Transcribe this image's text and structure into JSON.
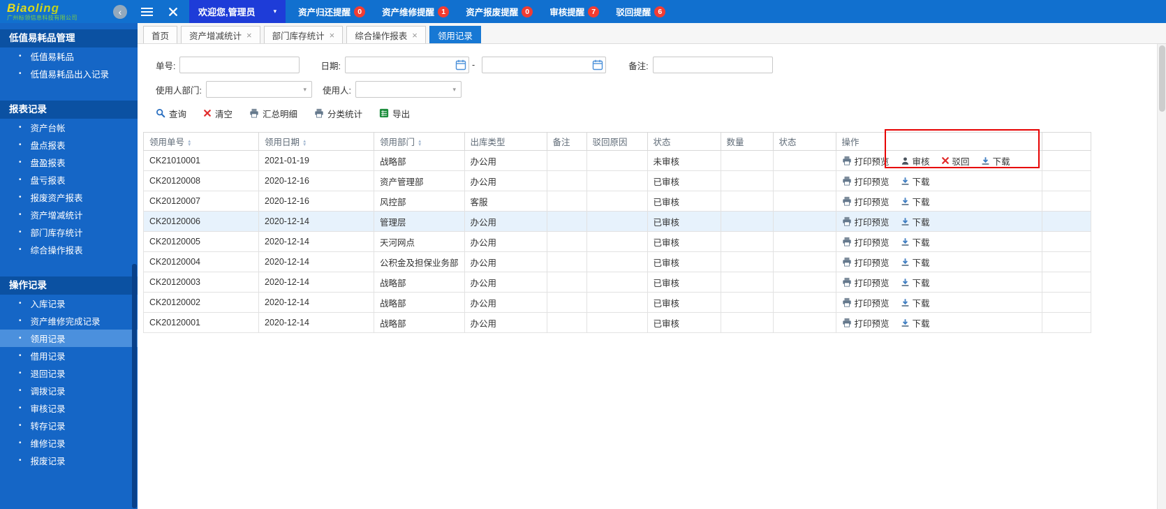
{
  "topbar": {
    "brand": "Biaoling",
    "brand_sub": "广州标领信息科技有限公司",
    "welcome_label": "欢迎您,管理员",
    "notifications": [
      {
        "label": "资产归还提醒",
        "count": "0"
      },
      {
        "label": "资产维修提醒",
        "count": "1"
      },
      {
        "label": "资产报废提醒",
        "count": "0"
      },
      {
        "label": "审核提醒",
        "count": "7"
      },
      {
        "label": "驳回提醒",
        "count": "6"
      }
    ]
  },
  "sidebar": {
    "sections": [
      {
        "title": "低值易耗品管理",
        "items": [
          {
            "label": "低值易耗品",
            "active": false
          },
          {
            "label": "低值易耗品出入记录",
            "active": false
          }
        ]
      },
      {
        "title": "报表记录",
        "items": [
          {
            "label": "资产台帐",
            "active": false
          },
          {
            "label": "盘点报表",
            "active": false
          },
          {
            "label": "盘盈报表",
            "active": false
          },
          {
            "label": "盘亏报表",
            "active": false
          },
          {
            "label": "报废资产报表",
            "active": false
          },
          {
            "label": "资产增减统计",
            "active": false
          },
          {
            "label": "部门库存统计",
            "active": false
          },
          {
            "label": "综合操作报表",
            "active": false
          }
        ]
      },
      {
        "title": "操作记录",
        "items": [
          {
            "label": "入库记录",
            "active": false
          },
          {
            "label": "资产维修完成记录",
            "active": false
          },
          {
            "label": "领用记录",
            "active": true
          },
          {
            "label": "借用记录",
            "active": false
          },
          {
            "label": "退回记录",
            "active": false
          },
          {
            "label": "调拨记录",
            "active": false
          },
          {
            "label": "审核记录",
            "active": false
          },
          {
            "label": "转存记录",
            "active": false
          },
          {
            "label": "维修记录",
            "active": false
          },
          {
            "label": "报废记录",
            "active": false
          }
        ]
      }
    ]
  },
  "tabs": [
    {
      "label": "首页",
      "name": "home",
      "closable": false,
      "active": false
    },
    {
      "label": "资产增减统计",
      "name": "asset-change-statistics",
      "closable": true,
      "active": false
    },
    {
      "label": "部门库存统计",
      "name": "department-inventory-statistics",
      "closable": true,
      "active": false
    },
    {
      "label": "综合操作报表",
      "name": "comprehensive-operation-report",
      "closable": true,
      "active": false
    },
    {
      "label": "领用记录",
      "name": "requisition-records",
      "closable": false,
      "active": true
    }
  ],
  "filters": {
    "order_no": {
      "label": "单号:",
      "value": ""
    },
    "date": {
      "label": "日期:",
      "from": "",
      "to": "",
      "separator": "-"
    },
    "remark": {
      "label": "备注:",
      "value": ""
    },
    "user_dept": {
      "label": "使用人部门:",
      "value": ""
    },
    "user": {
      "label": "使用人:",
      "value": ""
    }
  },
  "toolbar": {
    "buttons": [
      {
        "label": "查询",
        "name": "query-button",
        "icon": "search-icon"
      },
      {
        "label": "清空",
        "name": "clear-button",
        "icon": "clear-icon"
      },
      {
        "label": "汇总明细",
        "name": "summary-detail-button",
        "icon": "printer-icon"
      },
      {
        "label": "分类统计",
        "name": "category-stats-button",
        "icon": "printer-icon"
      },
      {
        "label": "导出",
        "name": "export-button",
        "icon": "export-icon"
      }
    ]
  },
  "table": {
    "columns": [
      {
        "label": "领用单号",
        "key": "order_no",
        "sortable": true
      },
      {
        "label": "领用日期",
        "key": "date",
        "sortable": true
      },
      {
        "label": "领用部门",
        "key": "dept",
        "sortable": true
      },
      {
        "label": "出库类型",
        "key": "out_type",
        "sortable": false
      },
      {
        "label": "备注",
        "key": "remark",
        "sortable": false
      },
      {
        "label": "驳回原因",
        "key": "reject_reason",
        "sortable": false
      },
      {
        "label": "状态",
        "key": "status",
        "sortable": false
      },
      {
        "label": "数量",
        "key": "qty",
        "sortable": false
      },
      {
        "label": "状态",
        "key": "status2",
        "sortable": false
      },
      {
        "label": "操作",
        "key": "actions",
        "sortable": false
      }
    ],
    "action_defs": {
      "打印预览": {
        "name": "print-preview-button",
        "icon": "printer-icon"
      },
      "审核": {
        "name": "approve-button",
        "icon": "user-icon"
      },
      "驳回": {
        "name": "reject-button",
        "icon": "reject-icon"
      },
      "下载": {
        "name": "download-button",
        "icon": "download-icon"
      }
    },
    "rows": [
      {
        "order_no": "CK21010001",
        "date": "2021-01-19",
        "dept": "战略部",
        "out_type": "办公用",
        "remark": "",
        "reject_reason": "",
        "status": "未审核",
        "qty": "",
        "status2": "",
        "actions": [
          "打印预览",
          "审核",
          "驳回",
          "下载"
        ],
        "selected": false
      },
      {
        "order_no": "CK20120008",
        "date": "2020-12-16",
        "dept": "资产管理部",
        "out_type": "办公用",
        "remark": "",
        "reject_reason": "",
        "status": "已审核",
        "qty": "",
        "status2": "",
        "actions": [
          "打印预览",
          "下载"
        ],
        "selected": false
      },
      {
        "order_no": "CK20120007",
        "date": "2020-12-16",
        "dept": "风控部",
        "out_type": "客服",
        "remark": "",
        "reject_reason": "",
        "status": "已审核",
        "qty": "",
        "status2": "",
        "actions": [
          "打印预览",
          "下载"
        ],
        "selected": false
      },
      {
        "order_no": "CK20120006",
        "date": "2020-12-14",
        "dept": "管理层",
        "out_type": "办公用",
        "remark": "",
        "reject_reason": "",
        "status": "已审核",
        "qty": "",
        "status2": "",
        "actions": [
          "打印预览",
          "下载"
        ],
        "selected": true
      },
      {
        "order_no": "CK20120005",
        "date": "2020-12-14",
        "dept": "天河网点",
        "out_type": "办公用",
        "remark": "",
        "reject_reason": "",
        "status": "已审核",
        "qty": "",
        "status2": "",
        "actions": [
          "打印预览",
          "下载"
        ],
        "selected": false
      },
      {
        "order_no": "CK20120004",
        "date": "2020-12-14",
        "dept": "公积金及担保业务部",
        "out_type": "办公用",
        "remark": "",
        "reject_reason": "",
        "status": "已审核",
        "qty": "",
        "status2": "",
        "actions": [
          "打印预览",
          "下载"
        ],
        "selected": false
      },
      {
        "order_no": "CK20120003",
        "date": "2020-12-14",
        "dept": "战略部",
        "out_type": "办公用",
        "remark": "",
        "reject_reason": "",
        "status": "已审核",
        "qty": "",
        "status2": "",
        "actions": [
          "打印预览",
          "下载"
        ],
        "selected": false
      },
      {
        "order_no": "CK20120002",
        "date": "2020-12-14",
        "dept": "战略部",
        "out_type": "办公用",
        "remark": "",
        "reject_reason": "",
        "status": "已审核",
        "qty": "",
        "status2": "",
        "actions": [
          "打印预览",
          "下载"
        ],
        "selected": false
      },
      {
        "order_no": "CK20120001",
        "date": "2020-12-14",
        "dept": "战略部",
        "out_type": "办公用",
        "remark": "",
        "reject_reason": "",
        "status": "已审核",
        "qty": "",
        "status2": "",
        "actions": [
          "打印预览",
          "下载"
        ],
        "selected": false
      }
    ]
  },
  "annotation": {
    "color": "#e60000"
  }
}
